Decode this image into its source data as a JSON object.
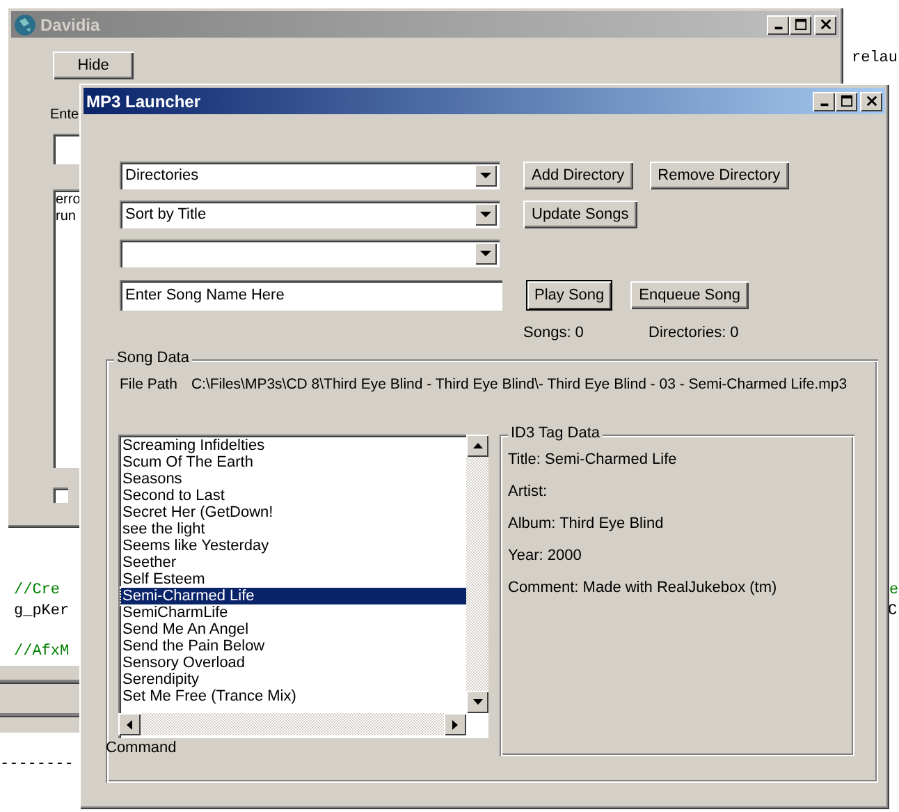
{
  "editor": {
    "fragments": [
      {
        "kind": "code",
        "text": "relau"
      },
      {
        "kind": "comment",
        "text": "//Cre"
      },
      {
        "kind": "comment",
        "text": "e"
      },
      {
        "kind": "code",
        "text": "g_pKer"
      },
      {
        "kind": "code",
        "text": "C"
      },
      {
        "kind": "comment",
        "text": "//AfxM"
      },
      {
        "kind": "code",
        "text": "--------"
      }
    ]
  },
  "back_window": {
    "title": "Davidia",
    "hide_button": "Hide",
    "label": "Ente",
    "log_lines": [
      "erro",
      "run"
    ],
    "checkbox": {
      "checked": false
    }
  },
  "window": {
    "title": "MP3 Launcher",
    "directories_combo": "Directories",
    "add_directory": "Add Directory",
    "remove_directory": "Remove Directory",
    "sort_combo": "Sort by Title",
    "update_songs": "Update Songs",
    "song_name": {
      "placeholder": "Enter Song Name Here"
    },
    "play_song": "Play Song",
    "enqueue_song": "Enqueue Song",
    "songs_count": "Songs: 0",
    "directories_count": "Directories: 0",
    "song_data": {
      "title": "Song Data",
      "file_path_label": "File Path",
      "file_path": "C:\\Files\\MP3s\\CD 8\\Third Eye Blind - Third Eye Blind\\- Third Eye Blind - 03 - Semi-Charmed Life.mp3",
      "songs": [
        {
          "title": "Screaming Infidelties",
          "selected": false
        },
        {
          "title": "Scum Of The Earth",
          "selected": false
        },
        {
          "title": "Seasons",
          "selected": false
        },
        {
          "title": "Second to Last",
          "selected": false
        },
        {
          "title": "Secret Her (GetDown!",
          "selected": false
        },
        {
          "title": "see the light",
          "selected": false
        },
        {
          "title": "Seems like Yesterday",
          "selected": false
        },
        {
          "title": "Seether",
          "selected": false
        },
        {
          "title": "Self Esteem",
          "selected": false
        },
        {
          "title": "Semi-Charmed Life",
          "selected": true
        },
        {
          "title": "SemiCharmLife",
          "selected": false
        },
        {
          "title": "Send Me An Angel",
          "selected": false
        },
        {
          "title": "Send the Pain Below",
          "selected": false
        },
        {
          "title": "Sensory Overload",
          "selected": false
        },
        {
          "title": "Serendipity",
          "selected": false
        },
        {
          "title": "Set Me Free (Trance Mix)",
          "selected": false
        }
      ],
      "command_label": "Command",
      "id3": {
        "title": "ID3 Tag Data",
        "lines": [
          "Title: Semi-Charmed Life",
          "Artist:",
          "Album: Third Eye Blind",
          "Year: 2000",
          "Comment: Made with RealJukebox (tm)"
        ]
      }
    }
  }
}
